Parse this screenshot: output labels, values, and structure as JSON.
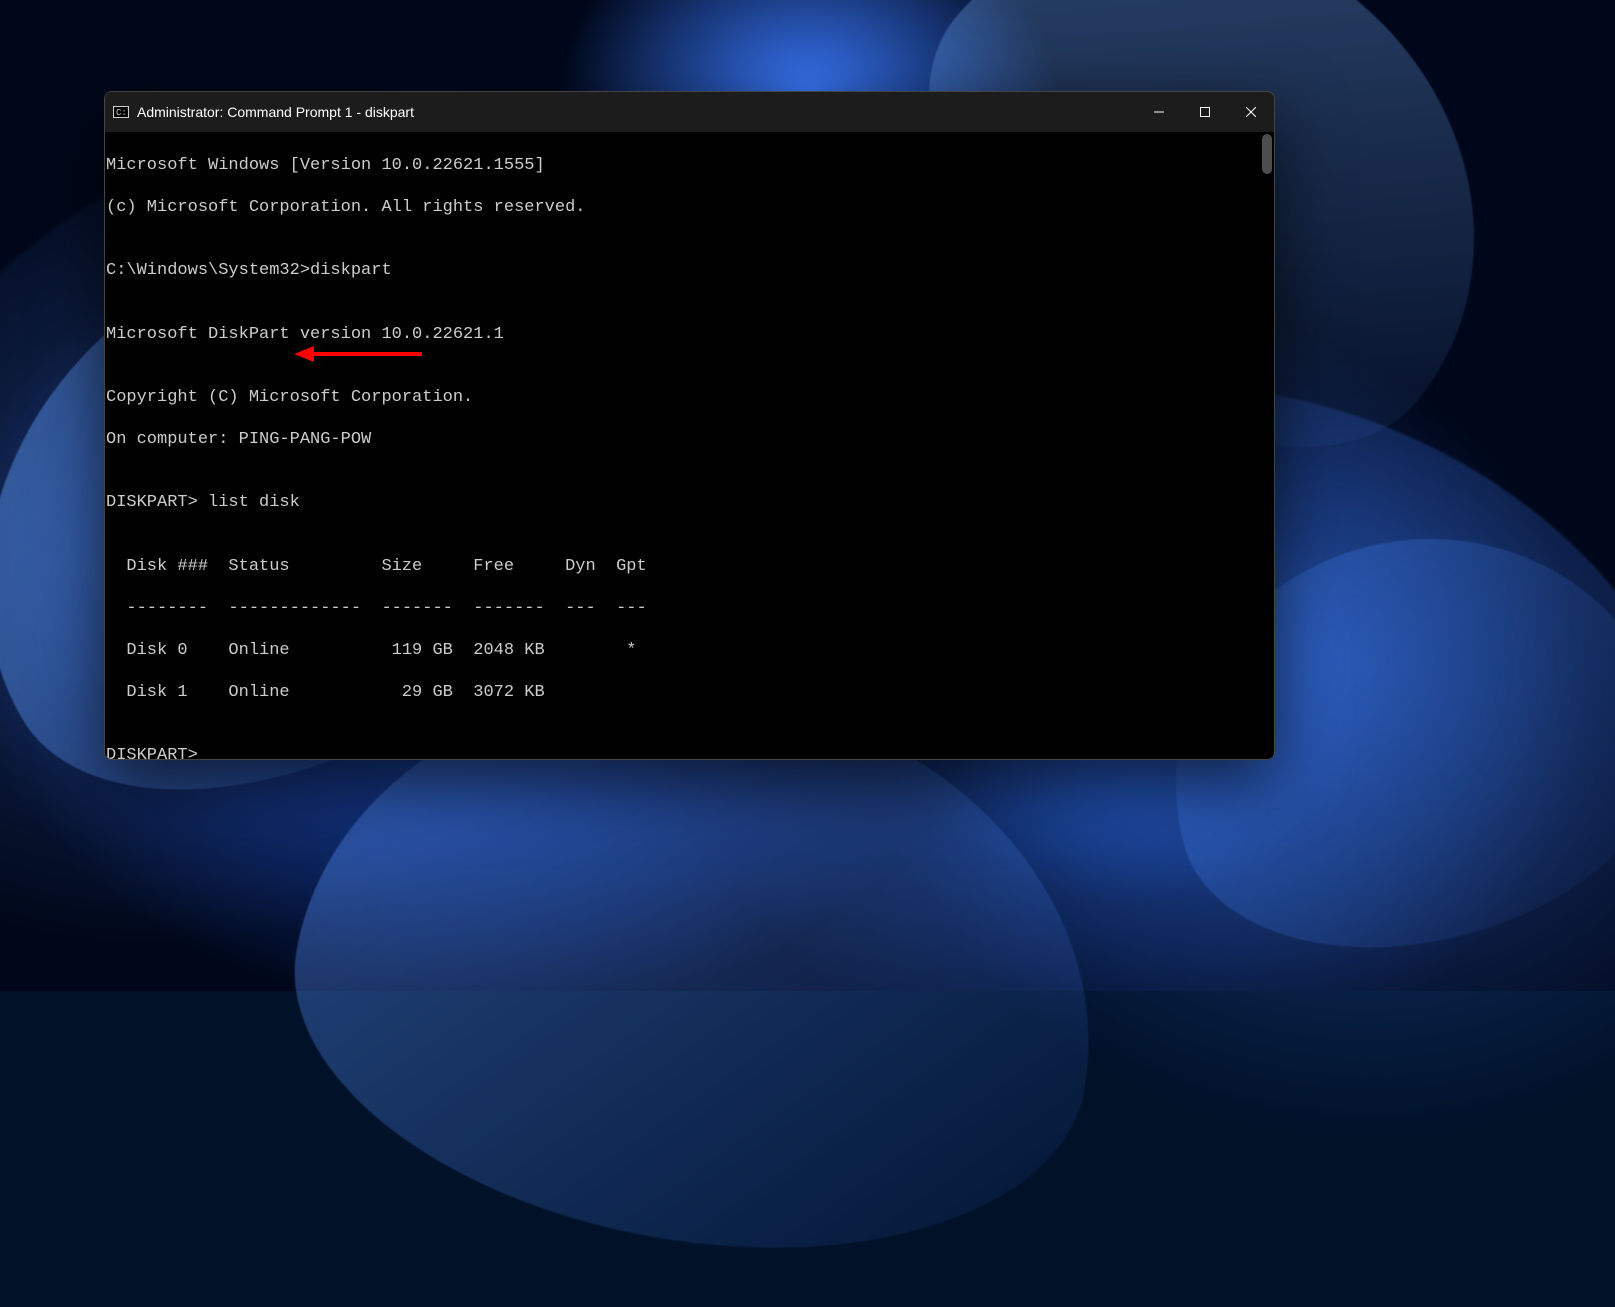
{
  "window": {
    "title": "Administrator: Command Prompt 1 - diskpart"
  },
  "terminal": {
    "lines": {
      "l0": "Microsoft Windows [Version 10.0.22621.1555]",
      "l1": "(c) Microsoft Corporation. All rights reserved.",
      "l2": "",
      "l3": "C:\\Windows\\System32>diskpart",
      "l4": "",
      "l5": "Microsoft DiskPart version 10.0.22621.1",
      "l6": "",
      "l7": "Copyright (C) Microsoft Corporation.",
      "l8": "On computer: PING-PANG-POW",
      "l9": "",
      "l10": "DISKPART> list disk",
      "l11": "",
      "l12": "  Disk ###  Status         Size     Free     Dyn  Gpt",
      "l13": "  --------  -------------  -------  -------  ---  ---",
      "l14": "  Disk 0    Online          119 GB  2048 KB        *",
      "l15": "  Disk 1    Online           29 GB  3072 KB",
      "l16": "",
      "l17": "DISKPART>"
    },
    "disks": [
      {
        "id": "Disk 0",
        "status": "Online",
        "size": "119 GB",
        "free": "2048 KB",
        "dyn": "",
        "gpt": "*"
      },
      {
        "id": "Disk 1",
        "status": "Online",
        "size": "29 GB",
        "free": "3072 KB",
        "dyn": "",
        "gpt": ""
      }
    ]
  },
  "annotation": {
    "color": "#ff0000"
  }
}
